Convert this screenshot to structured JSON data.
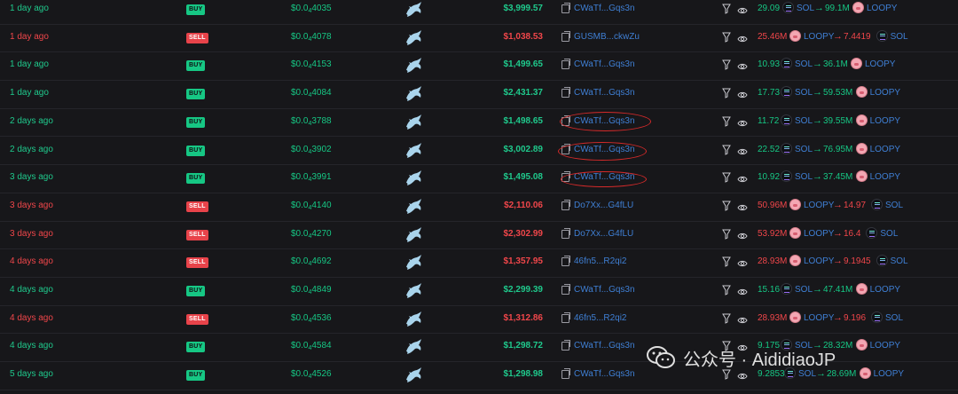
{
  "trades": [
    {
      "time": "1 day ago",
      "type": "BUY",
      "price_lead": "$0.0",
      "price_sub": "4",
      "price_tail": "4035",
      "value": "$3,999.57",
      "address": "CWaTf...Gqs3n",
      "from_amount": "29.09",
      "from_token": "SOL",
      "to_amount": "99.1M",
      "to_token": "LOOPY"
    },
    {
      "time": "1 day ago",
      "type": "SELL",
      "price_lead": "$0.0",
      "price_sub": "4",
      "price_tail": "4078",
      "value": "$1,038.53",
      "address": "GUSMB...ckwZu",
      "from_amount": "25.46M",
      "from_token": "LOOPY",
      "to_amount": "7.4419",
      "to_token": "SOL"
    },
    {
      "time": "1 day ago",
      "type": "BUY",
      "price_lead": "$0.0",
      "price_sub": "4",
      "price_tail": "4153",
      "value": "$1,499.65",
      "address": "CWaTf...Gqs3n",
      "from_amount": "10.93",
      "from_token": "SOL",
      "to_amount": "36.1M",
      "to_token": "LOOPY"
    },
    {
      "time": "1 day ago",
      "type": "BUY",
      "price_lead": "$0.0",
      "price_sub": "4",
      "price_tail": "4084",
      "value": "$2,431.37",
      "address": "CWaTf...Gqs3n",
      "from_amount": "17.73",
      "from_token": "SOL",
      "to_amount": "59.53M",
      "to_token": "LOOPY"
    },
    {
      "time": "2 days ago",
      "type": "BUY",
      "price_lead": "$0.0",
      "price_sub": "4",
      "price_tail": "3788",
      "value": "$1,498.65",
      "address": "CWaTf...Gqs3n",
      "from_amount": "11.72",
      "from_token": "SOL",
      "to_amount": "39.55M",
      "to_token": "LOOPY"
    },
    {
      "time": "2 days ago",
      "type": "BUY",
      "price_lead": "$0.0",
      "price_sub": "4",
      "price_tail": "3902",
      "value": "$3,002.89",
      "address": "CWaTf...Gqs3n",
      "from_amount": "22.52",
      "from_token": "SOL",
      "to_amount": "76.95M",
      "to_token": "LOOPY"
    },
    {
      "time": "3 days ago",
      "type": "BUY",
      "price_lead": "$0.0",
      "price_sub": "4",
      "price_tail": "3991",
      "value": "$1,495.08",
      "address": "CWaTf...Gqs3n",
      "from_amount": "10.92",
      "from_token": "SOL",
      "to_amount": "37.45M",
      "to_token": "LOOPY"
    },
    {
      "time": "3 days ago",
      "type": "SELL",
      "price_lead": "$0.0",
      "price_sub": "4",
      "price_tail": "4140",
      "value": "$2,110.06",
      "address": "Do7Xx...G4fLU",
      "from_amount": "50.96M",
      "from_token": "LOOPY",
      "to_amount": "14.97",
      "to_token": "SOL"
    },
    {
      "time": "3 days ago",
      "type": "SELL",
      "price_lead": "$0.0",
      "price_sub": "4",
      "price_tail": "4270",
      "value": "$2,302.99",
      "address": "Do7Xx...G4fLU",
      "from_amount": "53.92M",
      "from_token": "LOOPY",
      "to_amount": "16.4",
      "to_token": "SOL"
    },
    {
      "time": "4 days ago",
      "type": "SELL",
      "price_lead": "$0.0",
      "price_sub": "4",
      "price_tail": "4692",
      "value": "$1,357.95",
      "address": "46fn5...R2qi2",
      "from_amount": "28.93M",
      "from_token": "LOOPY",
      "to_amount": "9.1945",
      "to_token": "SOL"
    },
    {
      "time": "4 days ago",
      "type": "BUY",
      "price_lead": "$0.0",
      "price_sub": "4",
      "price_tail": "4849",
      "value": "$2,299.39",
      "address": "CWaTf...Gqs3n",
      "from_amount": "15.16",
      "from_token": "SOL",
      "to_amount": "47.41M",
      "to_token": "LOOPY"
    },
    {
      "time": "4 days ago",
      "type": "SELL",
      "price_lead": "$0.0",
      "price_sub": "4",
      "price_tail": "4536",
      "value": "$1,312.86",
      "address": "46fn5...R2qi2",
      "from_amount": "28.93M",
      "from_token": "LOOPY",
      "to_amount": "9.196",
      "to_token": "SOL"
    },
    {
      "time": "4 days ago",
      "type": "BUY",
      "price_lead": "$0.0",
      "price_sub": "4",
      "price_tail": "4584",
      "value": "$1,298.72",
      "address": "CWaTf...Gqs3n",
      "from_amount": "9.175",
      "from_token": "SOL",
      "to_amount": "28.32M",
      "to_token": "LOOPY"
    },
    {
      "time": "5 days ago",
      "type": "BUY",
      "price_lead": "$0.0",
      "price_sub": "4",
      "price_tail": "4526",
      "value": "$1,298.98",
      "address": "CWaTf...Gqs3n",
      "from_amount": "9.2853",
      "from_token": "SOL",
      "to_amount": "28.69M",
      "to_token": "LOOPY"
    }
  ],
  "watermark": {
    "text": "公众号 · AididiaoJP"
  },
  "colors": {
    "buy": "#16c784",
    "sell": "#e8434a",
    "link": "#3f7fd4",
    "highlight": "#d52a2a",
    "background": "#17171a"
  }
}
